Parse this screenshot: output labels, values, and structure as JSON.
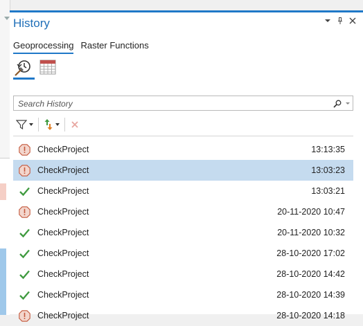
{
  "panel": {
    "title": "History",
    "controls": [
      "chevron-down-icon",
      "pin-icon",
      "close-icon"
    ]
  },
  "tabs": [
    {
      "label": "Geoprocessing",
      "active": true
    },
    {
      "label": "Raster Functions",
      "active": false
    }
  ],
  "views": [
    {
      "icon": "history-icon",
      "active": true
    },
    {
      "icon": "calendar-icon",
      "active": false
    }
  ],
  "search": {
    "placeholder": "Search History",
    "value": ""
  },
  "toolbar": {
    "filter_icon": "filter-icon",
    "sort_icon": "sort-icon",
    "remove_icon": "remove-icon"
  },
  "colors": {
    "accent": "#1f78c8",
    "selected_row": "#c5dbef",
    "warning": "#d4664a",
    "success": "#3f9a3f"
  },
  "history": [
    {
      "name": "CheckProject",
      "time": "13:13:35",
      "status": "warning",
      "selected": false
    },
    {
      "name": "CheckProject",
      "time": "13:03:23",
      "status": "warning",
      "selected": true
    },
    {
      "name": "CheckProject",
      "time": "13:03:21",
      "status": "success",
      "selected": false
    },
    {
      "name": "CheckProject",
      "time": "20-11-2020 10:47",
      "status": "warning",
      "selected": false
    },
    {
      "name": "CheckProject",
      "time": "20-11-2020 10:32",
      "status": "success",
      "selected": false
    },
    {
      "name": "CheckProject",
      "time": "28-10-2020 17:02",
      "status": "success",
      "selected": false
    },
    {
      "name": "CheckProject",
      "time": "28-10-2020 14:42",
      "status": "success",
      "selected": false
    },
    {
      "name": "CheckProject",
      "time": "28-10-2020 14:39",
      "status": "success",
      "selected": false
    },
    {
      "name": "CheckProject",
      "time": "28-10-2020 14:18",
      "status": "warning",
      "selected": false
    }
  ]
}
